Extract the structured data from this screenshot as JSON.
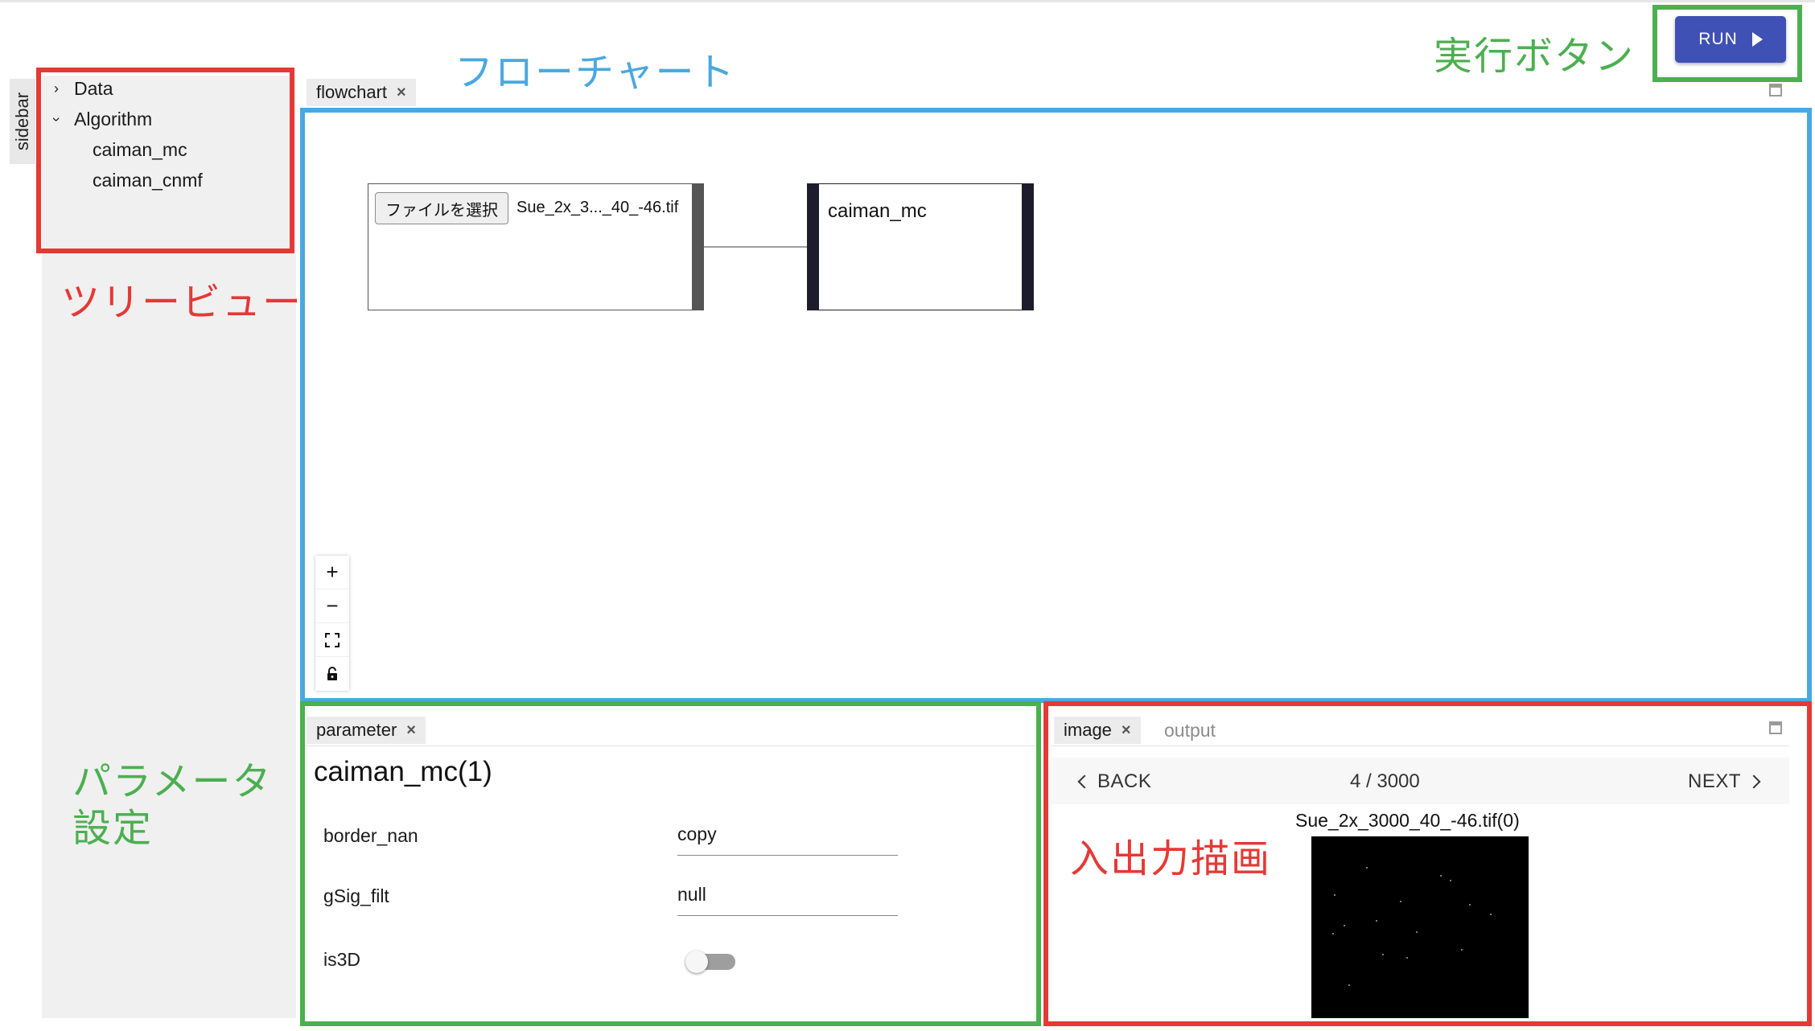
{
  "sidebar": {
    "tab_label": "sidebar",
    "tree": [
      {
        "label": "Data",
        "expanded": false
      },
      {
        "label": "Algorithm",
        "expanded": true,
        "children": [
          "caiman_mc",
          "caiman_cnmf"
        ]
      }
    ]
  },
  "annotations": {
    "flowchart": "フローチャート",
    "run": "実行ボタン",
    "treeview": "ツリービュー",
    "parameter_line1": "パラメータ",
    "parameter_line2": "設定",
    "io": "入出力描画"
  },
  "toolbar": {
    "run_label": "RUN"
  },
  "flowchart": {
    "tab_label": "flowchart",
    "input_node": {
      "file_button": "ファイルを選択",
      "file_name": "Sue_2x_3..._40_-46.tif"
    },
    "algo_node": {
      "label": "caiman_mc"
    },
    "controls": {
      "zoom_in": "+",
      "zoom_out": "−"
    }
  },
  "parameter": {
    "tab_label": "parameter",
    "title": "caiman_mc(1)",
    "fields": [
      {
        "label": "border_nan",
        "value": "copy"
      },
      {
        "label": "gSig_filt",
        "value": "null"
      },
      {
        "label": "is3D",
        "value": false
      }
    ]
  },
  "image_panel": {
    "tabs": [
      "image",
      "output"
    ],
    "back_label": "BACK",
    "next_label": "NEXT",
    "frame": "4 / 3000",
    "image_title": "Sue_2x_3000_40_-46.tif(0)"
  },
  "colors": {
    "red": "#e53935",
    "blue": "#4aa8e0",
    "green": "#4caf50",
    "run_button": "#3f51b5"
  }
}
